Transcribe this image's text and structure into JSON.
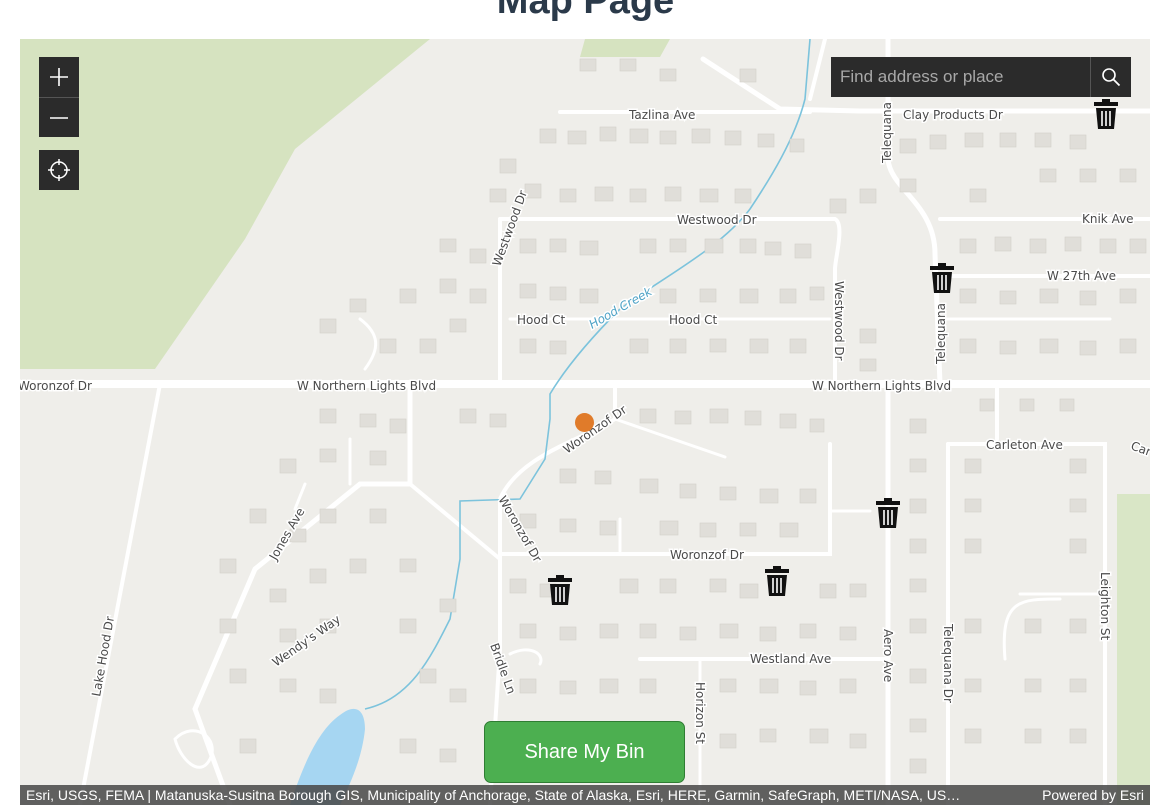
{
  "page": {
    "title": "Map Page"
  },
  "map": {
    "controls": {
      "zoom_in_icon": "plus-icon",
      "zoom_out_icon": "minus-icon",
      "locate_icon": "crosshair-icon"
    },
    "search": {
      "placeholder": "Find address or place",
      "icon": "search-icon"
    },
    "road_labels": {
      "tazlina_ave": "Tazlina Ave",
      "clay_products_dr": "Clay Products Dr",
      "westwood_dr_a": "Westwood Dr",
      "westwood_dr_b": "Westwood Dr",
      "westwood_dr_c": "Westwood Dr",
      "knik_ave": "Knik Ave",
      "w_27th_ave": "W 27th Ave",
      "hood_ct_a": "Hood Ct",
      "hood_ct_b": "Hood Ct",
      "hood_creek": "Hood Creek",
      "telequana_a": "Telequana",
      "telequana_b": "Telequana",
      "woronzof_dr_left": "Woronzof Dr",
      "w_northern_lights_a": "W Northern Lights Blvd",
      "w_northern_lights_b": "W Northern Lights Blvd",
      "woronzof_dr_curve": "Woronzof Dr",
      "woronzof_dr_vertical": "Woronzof Dr",
      "woronzof_dr_lower": "Woronzof Dr",
      "carleton_ave": "Carleton Ave",
      "car_partial": "Car",
      "jones_ave": "Jones Ave",
      "lake_hood_dr": "Lake Hood Dr",
      "wendys_way": "Wendy's Way",
      "bridle_ln": "Bridle Ln",
      "westland_ave": "Westland Ave",
      "horizon_st": "Horizon St",
      "aero_ave": "Aero Ave",
      "telequana_dr": "Telequana Dr",
      "leighton_st": "Leighton St"
    },
    "markers": {
      "bin_icon": "trash-bin-icon",
      "bin_count": 5,
      "location_color": "#e07b2a"
    },
    "attribution": {
      "sources": "Esri, USGS, FEMA | Matanuska-Susitna Borough GIS, Municipality of Anchorage, State of Alaska, Esri, HERE, Garmin, SafeGraph, METI/NASA, US…",
      "powered_by": "Powered by Esri"
    }
  },
  "actions": {
    "share_label": "Share My Bin",
    "share_color": "#4caf50"
  }
}
